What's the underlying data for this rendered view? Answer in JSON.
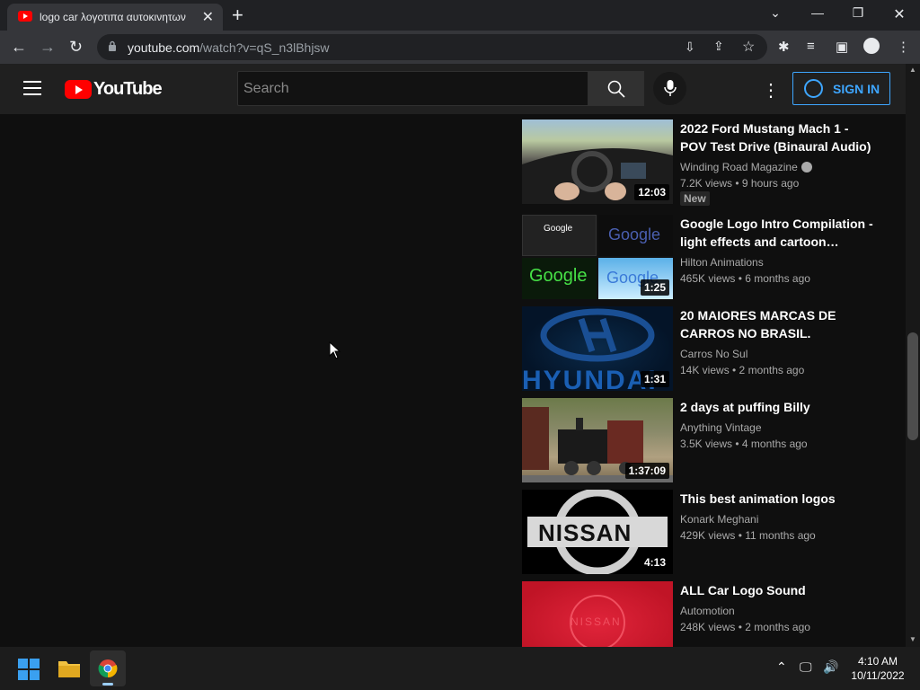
{
  "browser": {
    "tab_title": "logo car λογοτιπα αυτοκινητων",
    "url_domain": "youtube.com",
    "url_path": "/watch?v=qS_n3lBhjsw"
  },
  "header": {
    "logo_text": "YouTube",
    "search_placeholder": "Search",
    "signin_label": "SIGN IN"
  },
  "videos": [
    {
      "title": "2022 Ford Mustang Mach 1 - POV Test Drive (Binaural Audio)",
      "channel": "Winding Road Magazine",
      "meta": "7.2K views • 9 hours ago",
      "duration": "12:03",
      "badge": "New"
    },
    {
      "title": "Google Logo Intro Compilation - light effects and cartoon…",
      "channel": "Hilton Animations",
      "meta": "465K views • 6 months ago",
      "duration": "1:25"
    },
    {
      "title": "20 MAIORES MARCAS DE CARROS NO BRASIL.",
      "channel": "Carros No Sul",
      "meta": "14K views • 2 months ago",
      "duration": "1:31"
    },
    {
      "title": "2 days at puffing Billy",
      "channel": "Anything Vintage",
      "meta": "3.5K views • 4 months ago",
      "duration": "1:37:09"
    },
    {
      "title": "This best animation logos",
      "channel": "Konark Meghani",
      "meta": "429K views • 11 months ago",
      "duration": "4:13"
    },
    {
      "title": "ALL Car Logo Sound",
      "channel": "Automotion",
      "meta": "248K views • 2 months ago",
      "duration": ""
    }
  ],
  "thumb_text": {
    "google": "Google",
    "hyundai": "HYUNDAI",
    "nissan": "NISSAN"
  },
  "taskbar": {
    "time": "4:10 AM",
    "date": "10/11/2022"
  },
  "colors": {
    "accent": "#3ea6ff",
    "youtube_red": "#ff0000"
  }
}
